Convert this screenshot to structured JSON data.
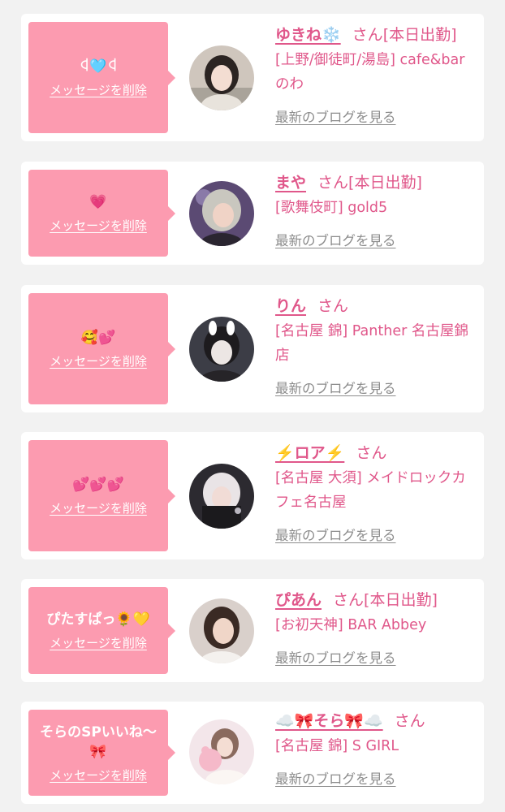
{
  "delete_label": "メッセージを削除",
  "blog_label": "最新のブログを見る",
  "honorific": "さん",
  "cards": [
    {
      "message": "ꒉ🩵ꒉ",
      "name": "ゆきね❄️",
      "status": "[本日出勤]",
      "shop": "[上野/御徒町/湯島] cafe&bar のわ",
      "avatar_icon": "portrait-photo"
    },
    {
      "message": "💗",
      "name": "まや",
      "status": "[本日出勤]",
      "shop": "[歌舞伎町] gold5",
      "avatar_icon": "portrait-photo"
    },
    {
      "message": "🥰💕",
      "name": "りん",
      "status": "",
      "shop": "[名古屋 錦] Panther 名古屋錦店",
      "avatar_icon": "portrait-photo"
    },
    {
      "message": "💕💕💕",
      "name": "⚡️ロア⚡️",
      "status": "",
      "shop": "[名古屋 大須] メイドロックカフェ名古屋",
      "avatar_icon": "portrait-photo"
    },
    {
      "message": "ぴたすぱっ🌻💛",
      "name": "ぴあん",
      "status": "[本日出勤]",
      "shop": "[お初天神] BAR Abbey",
      "avatar_icon": "portrait-photo"
    },
    {
      "message": "そらのSPいいね〜🎀",
      "name": "☁️🎀そら🎀☁️",
      "status": "",
      "shop": "[名古屋 錦] S GIRL",
      "avatar_icon": "portrait-photo"
    }
  ],
  "colors": {
    "bubble": "#fc9bb0",
    "name": "#e0578a",
    "link_gray": "#8c8c8c",
    "background": "#f2f2f2"
  }
}
